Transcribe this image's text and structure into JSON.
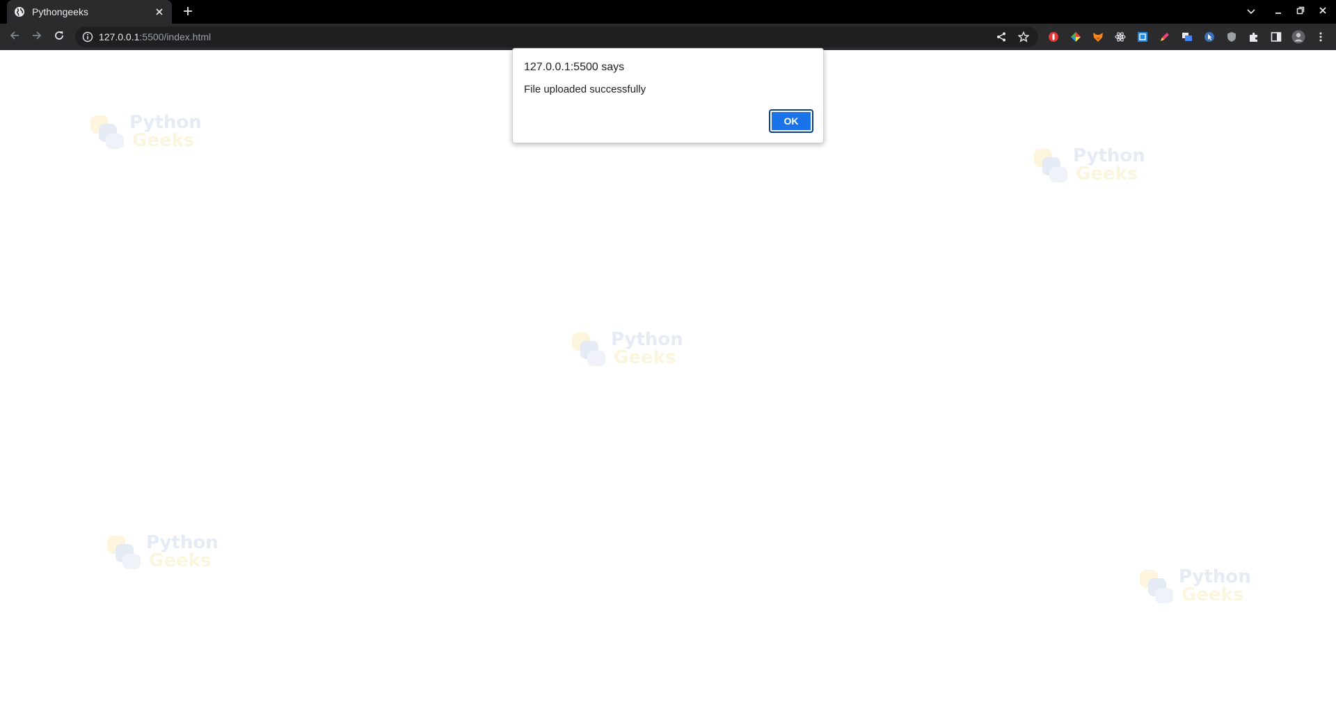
{
  "browser": {
    "tab": {
      "title": "Pythongeeks",
      "favicon": "globe-icon"
    },
    "address": {
      "host": "127.0.0.1",
      "rest": ":5500/index.html"
    },
    "colors": {
      "chrome": "#2b2b2d",
      "titlebar": "#000000",
      "accent": "#1a73e8"
    }
  },
  "watermark": {
    "line1": "Python",
    "line2": "Geeks"
  },
  "dialog": {
    "heading": "127.0.0.1:5500 says",
    "message": "File uploaded successfully",
    "ok_label": "OK"
  }
}
